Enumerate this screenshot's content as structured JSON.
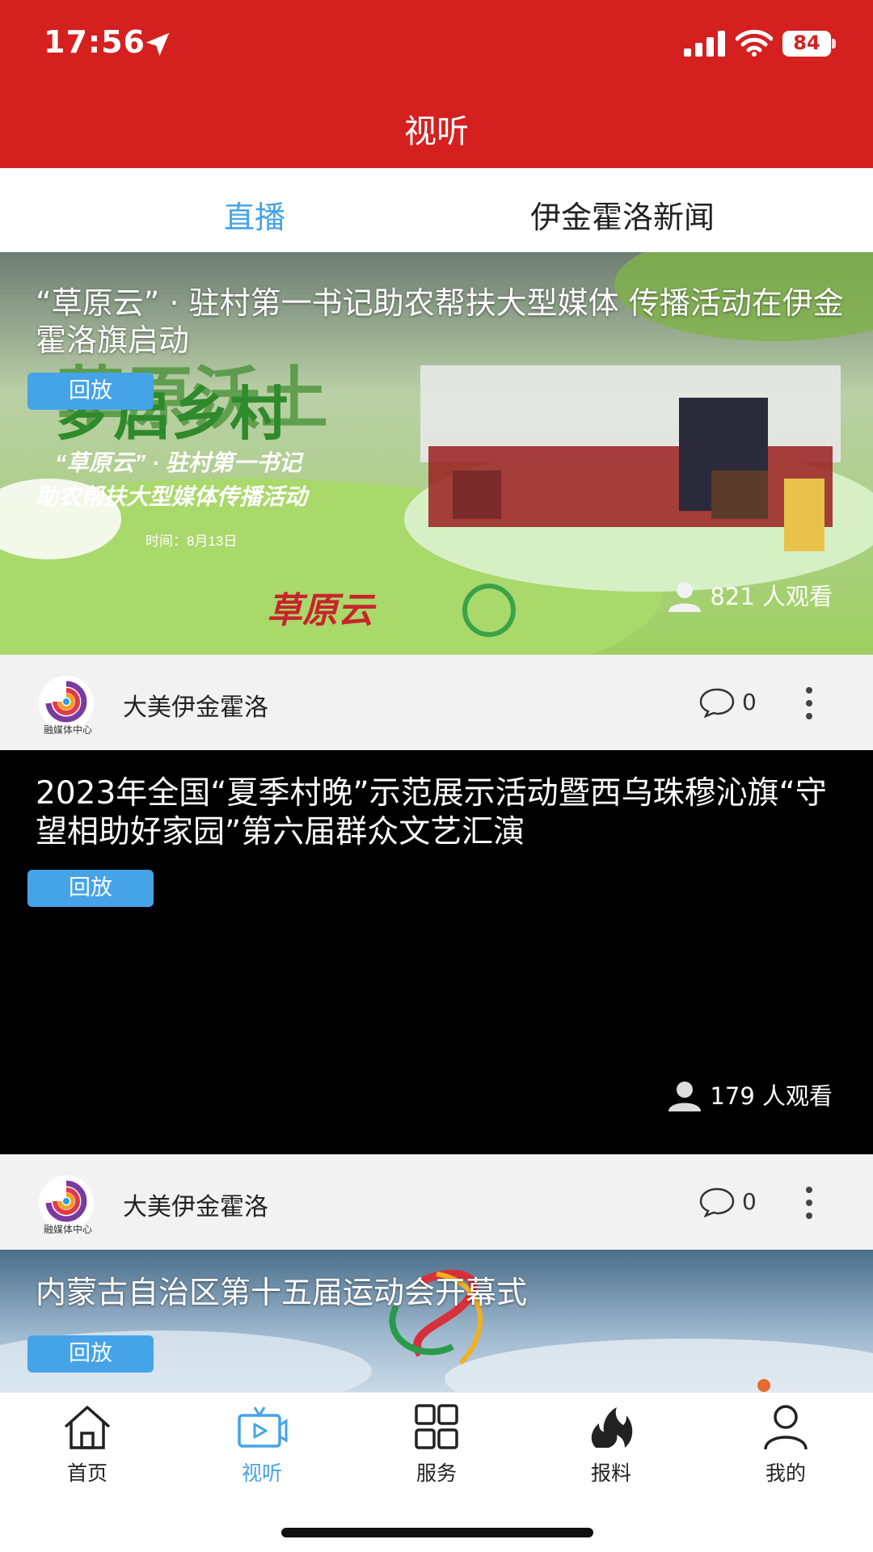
{
  "status_bar": {
    "time": "17:56",
    "battery": "84"
  },
  "header": {
    "title": "视听"
  },
  "tabs": [
    {
      "label": "直播",
      "active": true
    },
    {
      "label": "伊金霍洛新闻",
      "active": false
    }
  ],
  "cards": [
    {
      "title": "“草原云” · 驻村第一书记助农帮扶大型媒体 传播活动在伊金霍洛旗启动",
      "replay_label": "回放",
      "viewers": "821 人观看",
      "source": "大美伊金霍洛",
      "avatar_caption": "融媒体中心",
      "comments": "0"
    },
    {
      "title": "2023年全国“夏季村晚”示范展示活动暨西乌珠穆沁旗“守望相助好家园”第六届群众文艺汇演",
      "replay_label": "回放",
      "viewers": "179 人观看",
      "source": "大美伊金霍洛",
      "avatar_caption": "融媒体中心",
      "comments": "0"
    },
    {
      "title": "内蒙古自治区第十五届运动会开幕式",
      "replay_label": "回放"
    }
  ],
  "bottom_nav": [
    {
      "label": "首页",
      "icon": "home-icon"
    },
    {
      "label": "视听",
      "icon": "tv-icon",
      "active": true
    },
    {
      "label": "服务",
      "icon": "grid-icon"
    },
    {
      "label": "报料",
      "icon": "flame-icon"
    },
    {
      "label": "我的",
      "icon": "person-icon"
    }
  ],
  "colors": {
    "header": "#d52020",
    "accent": "#45a3e8"
  }
}
